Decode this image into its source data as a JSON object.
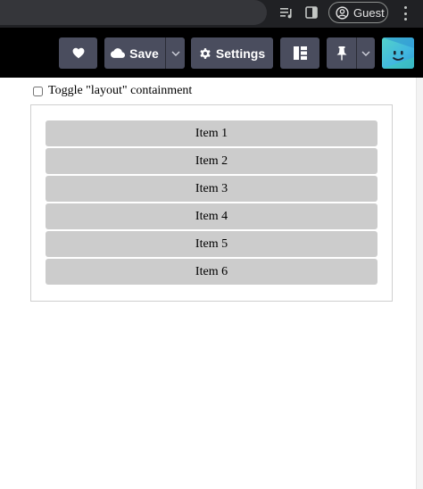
{
  "chrome": {
    "profile_label": "Guest"
  },
  "toolbar": {
    "save_label": "Save",
    "settings_label": "Settings"
  },
  "content": {
    "toggle_label": "Toggle \"layout\" containment",
    "items": [
      "Item 1",
      "Item 2",
      "Item 3",
      "Item 4",
      "Item 5",
      "Item 6"
    ]
  }
}
